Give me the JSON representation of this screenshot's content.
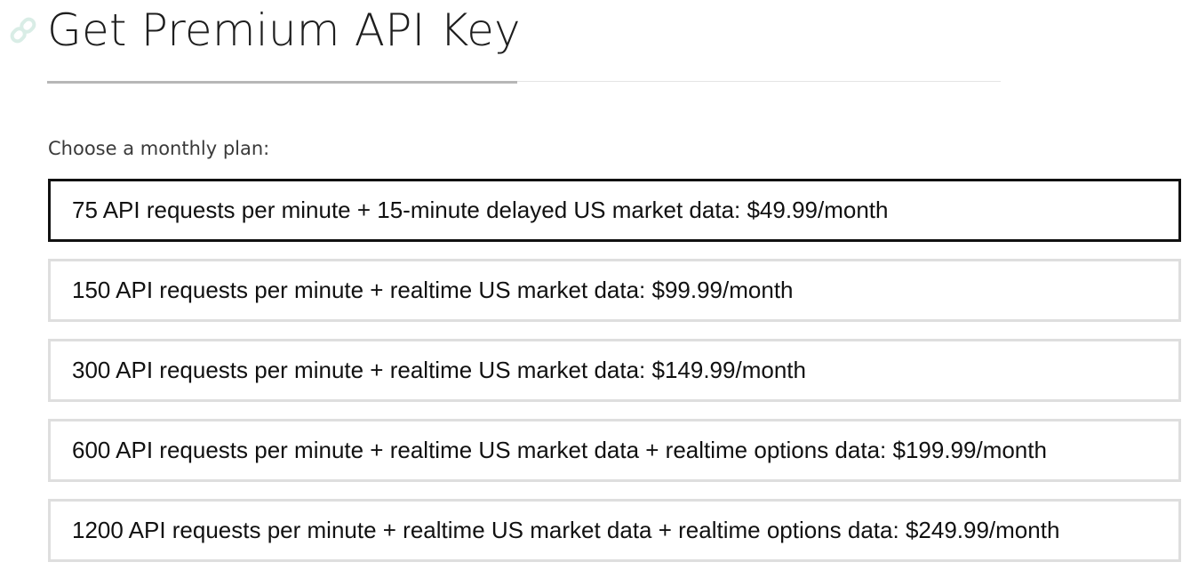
{
  "header": {
    "title": "Get Premium API Key",
    "anchor_icon": "link-icon",
    "anchor_icon_color": "#d9ede6"
  },
  "plan_prompt": "Choose a monthly plan:",
  "plans": [
    {
      "label": "75 API requests per minute + 15-minute delayed US market data: $49.99/month",
      "selected": true
    },
    {
      "label": "150 API requests per minute + realtime US market data: $99.99/month",
      "selected": false
    },
    {
      "label": "300 API requests per minute + realtime US market data: $149.99/month",
      "selected": false
    },
    {
      "label": "600 API requests per minute + realtime US market data + realtime options data: $199.99/month",
      "selected": false
    },
    {
      "label": "1200 API requests per minute + realtime US market data + realtime options data: $249.99/month",
      "selected": false
    }
  ],
  "colors": {
    "selected_border": "#111111",
    "unselected_border": "#dedede"
  }
}
